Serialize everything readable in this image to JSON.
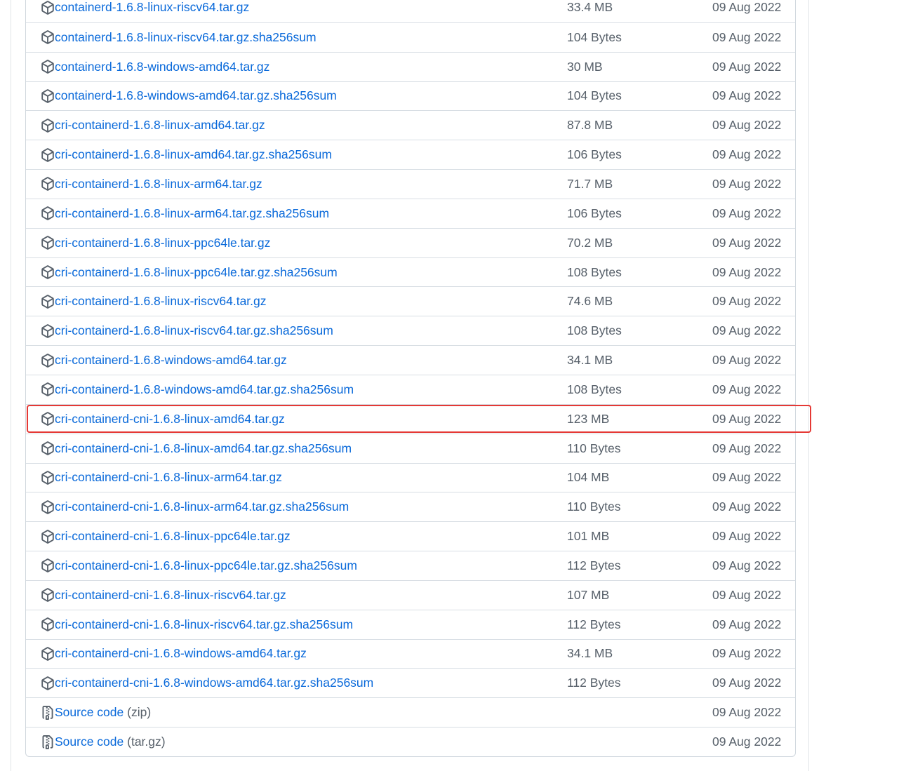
{
  "assets": [
    {
      "name": "containerd-1.6.8-linux-riscv64.tar.gz",
      "size": "33.4 MB",
      "date": "09 Aug 2022",
      "icon": "package-icon"
    },
    {
      "name": "containerd-1.6.8-linux-riscv64.tar.gz.sha256sum",
      "size": "104 Bytes",
      "date": "09 Aug 2022",
      "icon": "package-icon"
    },
    {
      "name": "containerd-1.6.8-windows-amd64.tar.gz",
      "size": "30 MB",
      "date": "09 Aug 2022",
      "icon": "package-icon"
    },
    {
      "name": "containerd-1.6.8-windows-amd64.tar.gz.sha256sum",
      "size": "104 Bytes",
      "date": "09 Aug 2022",
      "icon": "package-icon"
    },
    {
      "name": "cri-containerd-1.6.8-linux-amd64.tar.gz",
      "size": "87.8 MB",
      "date": "09 Aug 2022",
      "icon": "package-icon"
    },
    {
      "name": "cri-containerd-1.6.8-linux-amd64.tar.gz.sha256sum",
      "size": "106 Bytes",
      "date": "09 Aug 2022",
      "icon": "package-icon"
    },
    {
      "name": "cri-containerd-1.6.8-linux-arm64.tar.gz",
      "size": "71.7 MB",
      "date": "09 Aug 2022",
      "icon": "package-icon"
    },
    {
      "name": "cri-containerd-1.6.8-linux-arm64.tar.gz.sha256sum",
      "size": "106 Bytes",
      "date": "09 Aug 2022",
      "icon": "package-icon"
    },
    {
      "name": "cri-containerd-1.6.8-linux-ppc64le.tar.gz",
      "size": "70.2 MB",
      "date": "09 Aug 2022",
      "icon": "package-icon"
    },
    {
      "name": "cri-containerd-1.6.8-linux-ppc64le.tar.gz.sha256sum",
      "size": "108 Bytes",
      "date": "09 Aug 2022",
      "icon": "package-icon"
    },
    {
      "name": "cri-containerd-1.6.8-linux-riscv64.tar.gz",
      "size": "74.6 MB",
      "date": "09 Aug 2022",
      "icon": "package-icon"
    },
    {
      "name": "cri-containerd-1.6.8-linux-riscv64.tar.gz.sha256sum",
      "size": "108 Bytes",
      "date": "09 Aug 2022",
      "icon": "package-icon"
    },
    {
      "name": "cri-containerd-1.6.8-windows-amd64.tar.gz",
      "size": "34.1 MB",
      "date": "09 Aug 2022",
      "icon": "package-icon"
    },
    {
      "name": "cri-containerd-1.6.8-windows-amd64.tar.gz.sha256sum",
      "size": "108 Bytes",
      "date": "09 Aug 2022",
      "icon": "package-icon"
    },
    {
      "name": "cri-containerd-cni-1.6.8-linux-amd64.tar.gz",
      "size": "123 MB",
      "date": "09 Aug 2022",
      "icon": "package-icon",
      "highlighted": true
    },
    {
      "name": "cri-containerd-cni-1.6.8-linux-amd64.tar.gz.sha256sum",
      "size": "110 Bytes",
      "date": "09 Aug 2022",
      "icon": "package-icon"
    },
    {
      "name": "cri-containerd-cni-1.6.8-linux-arm64.tar.gz",
      "size": "104 MB",
      "date": "09 Aug 2022",
      "icon": "package-icon"
    },
    {
      "name": "cri-containerd-cni-1.6.8-linux-arm64.tar.gz.sha256sum",
      "size": "110 Bytes",
      "date": "09 Aug 2022",
      "icon": "package-icon"
    },
    {
      "name": "cri-containerd-cni-1.6.8-linux-ppc64le.tar.gz",
      "size": "101 MB",
      "date": "09 Aug 2022",
      "icon": "package-icon"
    },
    {
      "name": "cri-containerd-cni-1.6.8-linux-ppc64le.tar.gz.sha256sum",
      "size": "112 Bytes",
      "date": "09 Aug 2022",
      "icon": "package-icon"
    },
    {
      "name": "cri-containerd-cni-1.6.8-linux-riscv64.tar.gz",
      "size": "107 MB",
      "date": "09 Aug 2022",
      "icon": "package-icon"
    },
    {
      "name": "cri-containerd-cni-1.6.8-linux-riscv64.tar.gz.sha256sum",
      "size": "112 Bytes",
      "date": "09 Aug 2022",
      "icon": "package-icon"
    },
    {
      "name": "cri-containerd-cni-1.6.8-windows-amd64.tar.gz",
      "size": "34.1 MB",
      "date": "09 Aug 2022",
      "icon": "package-icon"
    },
    {
      "name": "cri-containerd-cni-1.6.8-windows-amd64.tar.gz.sha256sum",
      "size": "112 Bytes",
      "date": "09 Aug 2022",
      "icon": "package-icon"
    },
    {
      "name": "Source code",
      "suffix": "(zip)",
      "size": "",
      "date": "09 Aug 2022",
      "icon": "file-zip-icon"
    },
    {
      "name": "Source code",
      "suffix": "(tar.gz)",
      "size": "",
      "date": "09 Aug 2022",
      "icon": "file-zip-icon"
    }
  ],
  "colors": {
    "link": "#0969da",
    "muted": "#57606a",
    "border": "#d8dee4",
    "highlight": "#e53935"
  }
}
